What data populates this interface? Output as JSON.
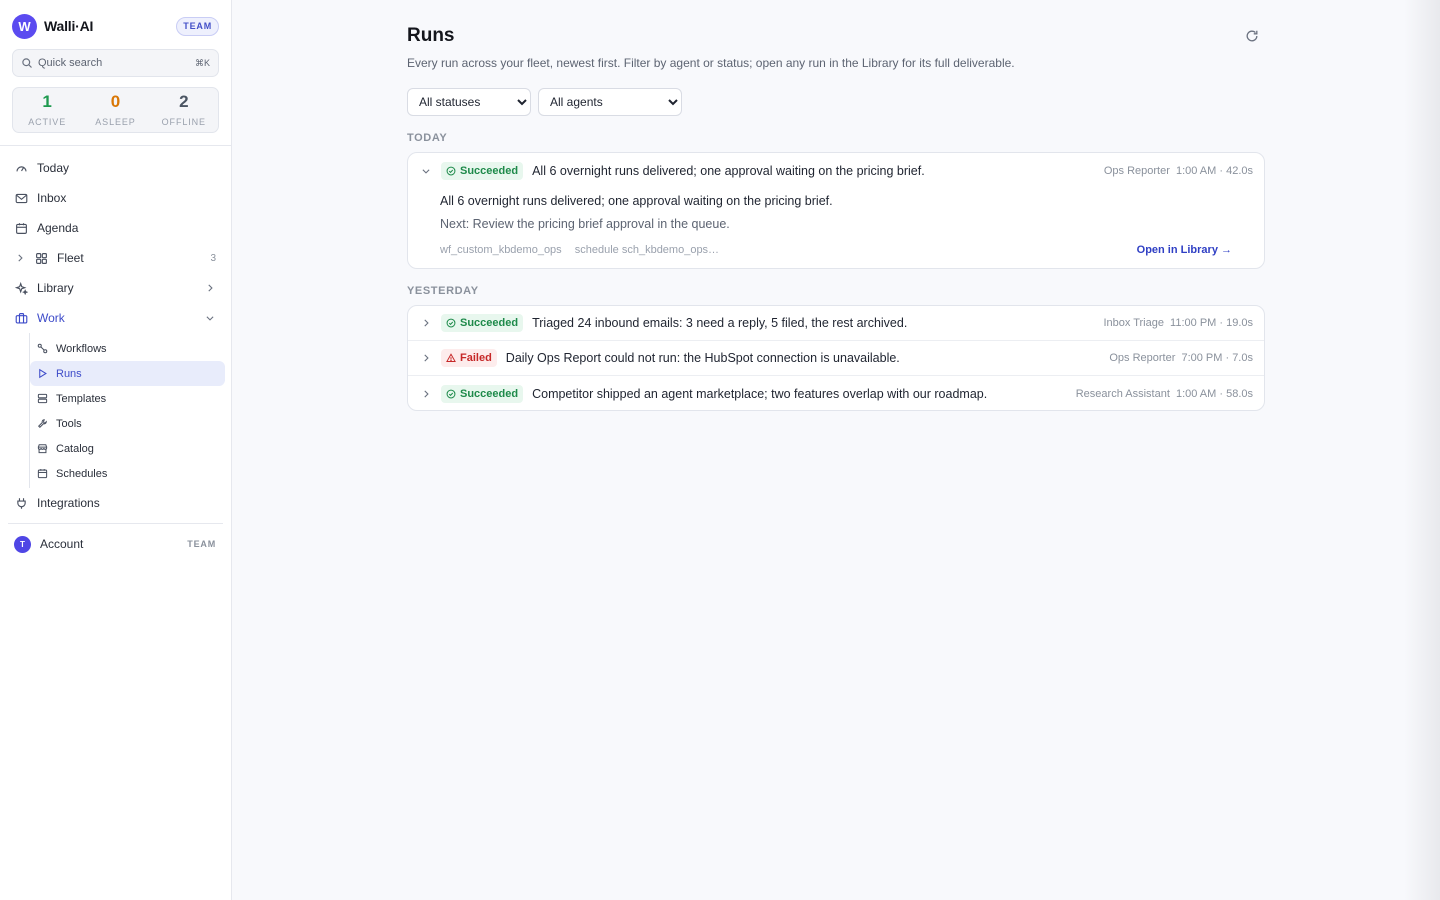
{
  "brand": {
    "logo_letter": "W",
    "name": "Walli·AI",
    "badge": "TEAM"
  },
  "search": {
    "placeholder": "Quick search",
    "shortcut": "⌘K",
    "icon": "search-icon"
  },
  "stats": [
    {
      "value": "1",
      "label": "ACTIVE",
      "color": "#1e9a4f"
    },
    {
      "value": "0",
      "label": "ASLEEP",
      "color": "#d97706"
    },
    {
      "value": "2",
      "label": "OFFLINE",
      "color": "#4b5563"
    }
  ],
  "nav": {
    "today": "Today",
    "inbox": "Inbox",
    "agenda": "Agenda",
    "fleet": "Fleet",
    "fleet_count": "3",
    "library": "Library",
    "work": "Work",
    "work_sub": {
      "workflows": "Workflows",
      "runs": "Runs",
      "templates": "Templates",
      "tools": "Tools",
      "catalog": "Catalog",
      "schedules": "Schedules"
    },
    "integrations": "Integrations",
    "account": "Account",
    "account_avatar": "T",
    "account_tag": "TEAM"
  },
  "main": {
    "title": "Runs",
    "subtitle": "Every run across your fleet, newest first. Filter by agent or status; open any run in the Library for its full deliverable.",
    "filters": {
      "status_selected": "All statuses",
      "agent_selected": "All agents"
    },
    "groups": {
      "today": {
        "label": "TODAY",
        "runs": [
          {
            "status": "Succeeded",
            "summary": "All 6 overnight runs delivered; one approval waiting on the pricing brief.",
            "agent": "Ops Reporter",
            "time": "1:00 AM · 42.0s",
            "expanded": {
              "summary": "All 6 overnight runs delivered; one approval waiting on the pricing brief.",
              "next": "Next: Review the pricing brief approval in the queue.",
              "workflow_id": "wf_custom_kbdemo_ops",
              "schedule_id": "schedule sch_kbdemo_ops…",
              "open_label": "Open in Library →"
            }
          }
        ]
      },
      "yesterday": {
        "label": "YESTERDAY",
        "runs": [
          {
            "status": "Succeeded",
            "summary": "Triaged 24 inbound emails: 3 need a reply, 5 filed, the rest archived.",
            "agent": "Inbox Triage",
            "time": "11:00 PM · 19.0s"
          },
          {
            "status": "Failed",
            "summary": "Daily Ops Report could not run: the HubSpot connection is unavailable.",
            "agent": "Ops Reporter",
            "time": "7:00 PM · 7.0s"
          },
          {
            "status": "Succeeded",
            "summary": "Competitor shipped an agent marketplace; two features overlap with our roadmap.",
            "agent": "Research Assistant",
            "time": "1:00 AM · 58.0s"
          }
        ]
      }
    }
  },
  "colors": {
    "accent": "#3d4bc9",
    "success": "#1e8a4a",
    "danger": "#c62828"
  }
}
